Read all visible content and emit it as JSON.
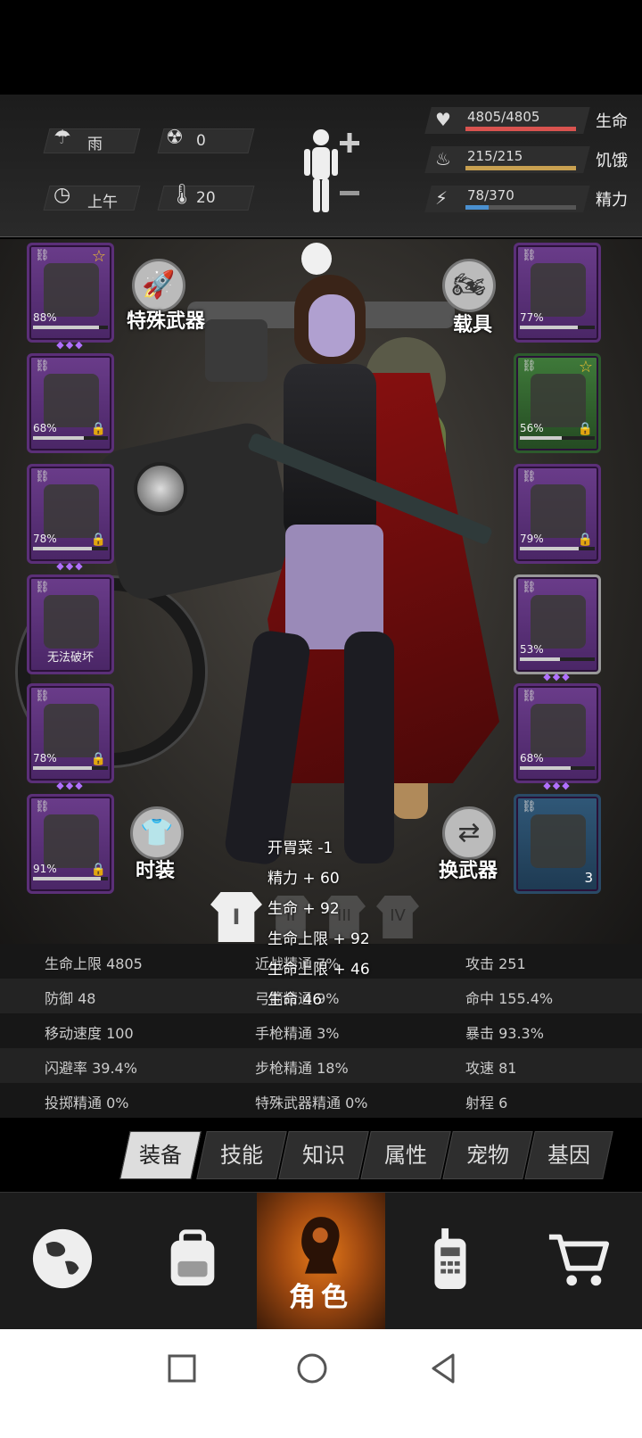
{
  "env": {
    "weather": "雨",
    "radiation": "0",
    "time": "上午",
    "temperature": "20"
  },
  "stats": [
    {
      "value": "4805/4805",
      "label": "生命",
      "fraction": 1.0,
      "color": "#d9534f"
    },
    {
      "value": "215/215",
      "label": "饥饿",
      "fraction": 1.0,
      "color": "#c8a050"
    },
    {
      "value": "78/370",
      "label": "精力",
      "fraction": 0.21,
      "color": "#4a90d0"
    }
  ],
  "left_slots": [
    {
      "pct": "88%",
      "fraction": 0.88,
      "star": true,
      "gems": "◆◆◆",
      "gem_colors": [
        "#55aaff",
        "#ffffff",
        "#cc66ff"
      ],
      "locked": false,
      "note": ""
    },
    {
      "pct": "68%",
      "fraction": 0.68,
      "star": false,
      "gems": "",
      "gem_colors": [],
      "locked": true,
      "note": ""
    },
    {
      "pct": "78%",
      "fraction": 0.78,
      "star": false,
      "gems": "◆◆◆",
      "gem_colors": [
        "#cc66ff",
        "#55aaff",
        "#ffffff"
      ],
      "locked": true,
      "note": ""
    },
    {
      "pct": "",
      "fraction": 0,
      "star": false,
      "gems": "",
      "gem_colors": [],
      "locked": false,
      "note": "无法破坏"
    },
    {
      "pct": "78%",
      "fraction": 0.78,
      "star": false,
      "gems": "◆◆◆",
      "gem_colors": [
        "#cc66ff",
        "#55aaff",
        "#ffffff"
      ],
      "locked": true,
      "note": ""
    },
    {
      "pct": "91%",
      "fraction": 0.91,
      "star": false,
      "gems": "",
      "gem_colors": [],
      "locked": true,
      "note": ""
    }
  ],
  "right_slots": [
    {
      "pct": "77%",
      "fraction": 0.77,
      "star": false,
      "gems": "",
      "locked": false,
      "style": "purple"
    },
    {
      "pct": "56%",
      "fraction": 0.56,
      "star": true,
      "gems": "",
      "locked": true,
      "style": "green"
    },
    {
      "pct": "79%",
      "fraction": 0.79,
      "star": false,
      "gems": "",
      "locked": true,
      "style": "purple"
    },
    {
      "pct": "53%",
      "fraction": 0.53,
      "star": false,
      "gems": "◆◆◆",
      "locked": false,
      "style": "grey"
    },
    {
      "pct": "68%",
      "fraction": 0.68,
      "star": false,
      "gems": "◆◆◆",
      "locked": false,
      "style": "purple"
    },
    {
      "pct": "",
      "fraction": 0,
      "star": false,
      "gems": "",
      "locked": false,
      "style": "blue",
      "count": "3"
    }
  ],
  "buttons": {
    "special_weapon": "特殊武器",
    "vehicle": "载具",
    "fashion": "时装",
    "swap_weapon": "换武器"
  },
  "outfit_tabs": [
    "I",
    "II",
    "III",
    "IV"
  ],
  "float_texts": [
    "开胃菜 -1",
    "精力 + 60",
    "生命 + 92",
    "生命上限 + 92",
    "生命上限 + 46",
    "生命 46"
  ],
  "attributes": [
    [
      "生命上限 4805",
      "近战精通 7%",
      "攻击 251"
    ],
    [
      "防御 48",
      "弓箭精通 9%",
      "命中 155.4%"
    ],
    [
      "移动速度 100",
      "手枪精通 3%",
      "暴击 93.3%"
    ],
    [
      "闪避率 39.4%",
      "步枪精通 18%",
      "攻速 81"
    ],
    [
      "投掷精通 0%",
      "特殊武器精通 0%",
      "射程 6"
    ]
  ],
  "tabs": [
    "装备",
    "技能",
    "知识",
    "属性",
    "宠物",
    "基因"
  ],
  "nav": {
    "icons": [
      "globe-icon",
      "backpack-icon",
      "character-icon",
      "radio-icon",
      "cart-icon"
    ],
    "active_label": "角色"
  }
}
